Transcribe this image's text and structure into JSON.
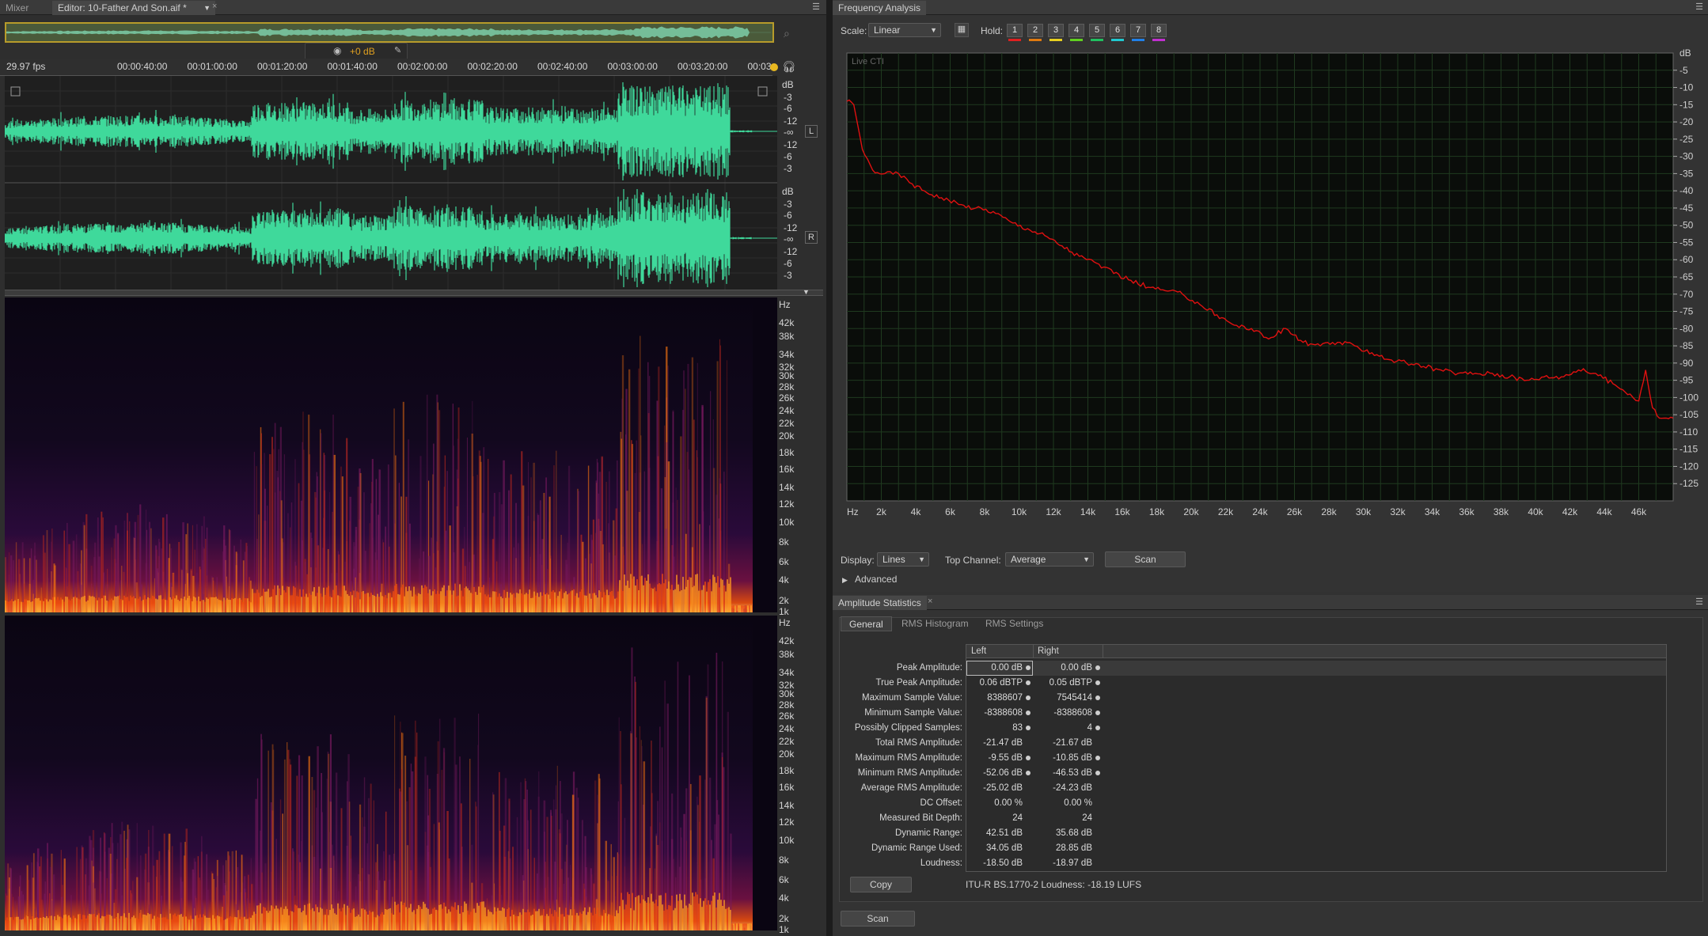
{
  "tabs_left": {
    "mixer": "Mixer",
    "editor": "Editor: 10-Father And Son.aif *"
  },
  "hud": {
    "volume": "+0 dB"
  },
  "timeline": {
    "fps": "29.97 fps",
    "ticks": [
      "00:00:40:00",
      "00:01:00:00",
      "00:01:20:00",
      "00:01:40:00",
      "00:02:00:00",
      "00:02:20:00",
      "00:02:40:00",
      "00:03:00:00",
      "00:03:20:00",
      "00:03"
    ]
  },
  "waveform": {
    "unit": "dB",
    "scale_labels": [
      "-3",
      "-6",
      "-12",
      "-∞",
      "-12",
      "-6",
      "-3"
    ],
    "channels": [
      "L",
      "R"
    ],
    "fill_color": "#3fd99b"
  },
  "spectrogram": {
    "unit": "Hz",
    "labels": [
      "42k",
      "38k",
      "34k",
      "32k",
      "30k",
      "28k",
      "26k",
      "24k",
      "22k",
      "20k",
      "18k",
      "16k",
      "14k",
      "12k",
      "10k",
      "8k",
      "6k",
      "4k",
      "2k",
      "1k"
    ]
  },
  "freq": {
    "title": "Frequency Analysis",
    "scale_label": "Scale:",
    "scale_value": "Linear",
    "hold_label": "Hold:",
    "hold_buttons": [
      {
        "n": "1",
        "color": "#e02020"
      },
      {
        "n": "2",
        "color": "#e07a10"
      },
      {
        "n": "3",
        "color": "#e8d020"
      },
      {
        "n": "4",
        "color": "#60d020"
      },
      {
        "n": "5",
        "color": "#20c060"
      },
      {
        "n": "6",
        "color": "#20c8d0"
      },
      {
        "n": "7",
        "color": "#2080e8"
      },
      {
        "n": "8",
        "color": "#c030d0"
      }
    ],
    "live_label": "Live CTI",
    "display_label": "Display:",
    "display_value": "Lines",
    "top_channel_label": "Top Channel:",
    "top_channel_value": "Average",
    "scan": "Scan",
    "advanced": "Advanced",
    "curve_color": "#e01010",
    "chart_data": {
      "type": "line",
      "xlabel": "Hz",
      "ylabel": "dB",
      "x_ticks": [
        "2k",
        "4k",
        "6k",
        "8k",
        "10k",
        "12k",
        "14k",
        "16k",
        "18k",
        "20k",
        "22k",
        "24k",
        "26k",
        "28k",
        "30k",
        "32k",
        "34k",
        "36k",
        "38k",
        "40k",
        "42k",
        "44k",
        "46k"
      ],
      "y_ticks": [
        "-5",
        "-10",
        "-15",
        "-20",
        "-25",
        "-30",
        "-35",
        "-40",
        "-45",
        "-50",
        "-55",
        "-60",
        "-65",
        "-70",
        "-75",
        "-80",
        "-85",
        "-90",
        "-95",
        "-100",
        "-105",
        "-110",
        "-115",
        "-120",
        "-125"
      ],
      "xlim": [
        0,
        48000
      ],
      "ylim": [
        -130,
        0
      ],
      "series": [
        {
          "x": [
            0,
            400,
            900,
            1500,
            2200,
            3000,
            3800,
            4500,
            5500,
            6500,
            7500,
            8500,
            9500,
            10500,
            11500,
            12500,
            13500,
            14500,
            15500,
            16500,
            17500,
            18500,
            19500,
            20500,
            21500,
            22500,
            23500,
            24500,
            25500,
            26500,
            27500,
            28500,
            29500,
            30500,
            31500,
            32500,
            33500,
            34500,
            35500,
            36500,
            37500,
            38500,
            39500,
            40500,
            41500,
            42500,
            43500,
            44500,
            45500,
            46000,
            46400,
            46800,
            47200,
            47600,
            48000
          ],
          "y": [
            -14,
            -15,
            -28,
            -34,
            -35,
            -35,
            -38,
            -40,
            -42,
            -44,
            -45,
            -46,
            -49,
            -51,
            -53,
            -56,
            -59,
            -61,
            -64,
            -66,
            -68,
            -69,
            -70,
            -73,
            -76,
            -79,
            -80,
            -83,
            -80,
            -84,
            -85,
            -84,
            -85,
            -87,
            -89,
            -90,
            -91,
            -92,
            -93,
            -93,
            -93,
            -94,
            -95,
            -94,
            -94,
            -92,
            -93,
            -96,
            -99,
            -101,
            -92,
            -103,
            -106,
            -106,
            -106
          ]
        }
      ]
    }
  },
  "amp": {
    "title": "Amplitude Statistics",
    "tabs": [
      "General",
      "RMS Histogram",
      "RMS Settings"
    ],
    "col_left": "Left",
    "col_right": "Right",
    "rows": [
      {
        "label": "Peak Amplitude:",
        "left": "0.00 dB",
        "right": "0.00 dB",
        "ld": true,
        "rd": true
      },
      {
        "label": "True Peak Amplitude:",
        "left": "0.06 dBTP",
        "right": "0.05 dBTP",
        "ld": true,
        "rd": true
      },
      {
        "label": "Maximum Sample Value:",
        "left": "8388607",
        "right": "7545414",
        "ld": true,
        "rd": true
      },
      {
        "label": "Minimum Sample Value:",
        "left": "-8388608",
        "right": "-8388608",
        "ld": true,
        "rd": true
      },
      {
        "label": "Possibly Clipped Samples:",
        "left": "83",
        "right": "4",
        "ld": true,
        "rd": true
      },
      {
        "label": "Total RMS Amplitude:",
        "left": "-21.47 dB",
        "right": "-21.67 dB",
        "ld": false,
        "rd": false
      },
      {
        "label": "Maximum RMS Amplitude:",
        "left": "-9.55 dB",
        "right": "-10.85 dB",
        "ld": true,
        "rd": true
      },
      {
        "label": "Minimum RMS Amplitude:",
        "left": "-52.06 dB",
        "right": "-46.53 dB",
        "ld": true,
        "rd": true
      },
      {
        "label": "Average RMS Amplitude:",
        "left": "-25.02 dB",
        "right": "-24.23 dB",
        "ld": false,
        "rd": false
      },
      {
        "label": "DC Offset:",
        "left": "0.00 %",
        "right": "0.00 %",
        "ld": false,
        "rd": false
      },
      {
        "label": "Measured Bit Depth:",
        "left": "24",
        "right": "24",
        "ld": false,
        "rd": false
      },
      {
        "label": "Dynamic Range:",
        "left": "42.51 dB",
        "right": "35.68 dB",
        "ld": false,
        "rd": false
      },
      {
        "label": "Dynamic Range Used:",
        "left": "34.05 dB",
        "right": "28.85 dB",
        "ld": false,
        "rd": false
      },
      {
        "label": "Loudness:",
        "left": "-18.50 dB",
        "right": "-18.97 dB",
        "ld": false,
        "rd": false
      }
    ],
    "copy": "Copy",
    "itu": "ITU-R BS.1770-2 Loudness: -18.19 LUFS",
    "scan": "Scan"
  }
}
